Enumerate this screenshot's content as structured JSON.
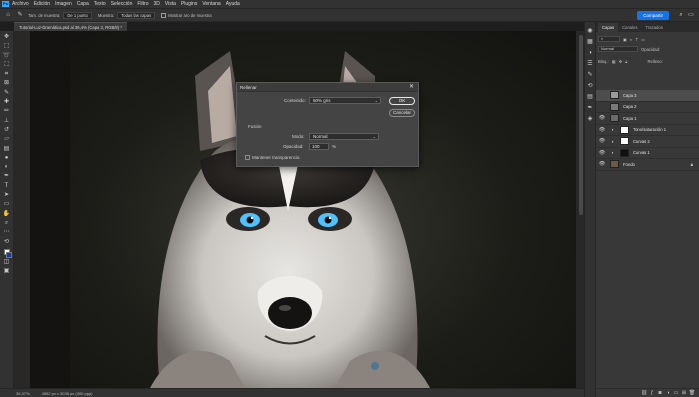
{
  "menu": {
    "app_icon": "Ps",
    "items": [
      "Archivo",
      "Edición",
      "Imagen",
      "Capa",
      "Texto",
      "Selección",
      "Filtro",
      "3D",
      "Vista",
      "Plugins",
      "Ventana",
      "Ayuda"
    ]
  },
  "options": {
    "sample_size_label": "Tam. de muestra:",
    "sample_size_value": "De 1 punto",
    "sample_label": "Muestra:",
    "sample_value": "Todas las capas",
    "ring_label": "Mostrar aro de muestra",
    "share_label": "Compartir"
  },
  "document": {
    "tab_title": "Tutorial-Luz-Dramática.psd al 36,4% (Capa 3, RGB/8) *"
  },
  "status": {
    "zoom": "36,37%",
    "info": "4552 px x 3035 px (300 ppp)"
  },
  "dialog": {
    "title": "Rellenar",
    "contents_label": "Contenido:",
    "contents_value": "50% gris",
    "ok_label": "OK",
    "cancel_label": "Cancelar",
    "fusion_label": "Fusión",
    "mode_label": "Modo:",
    "mode_value": "Normal",
    "opacity_label": "Opacidad:",
    "opacity_value": "100",
    "opacity_unit": "%",
    "preserve_label": "Mantener transparencia"
  },
  "panel": {
    "tabs": [
      "Capas",
      "Canales",
      "Trazados"
    ],
    "kind_label": "Normal",
    "opacity_label": "Opacidad:",
    "lock_label": "Bloq.:",
    "fill_label": "Relleno:",
    "layers": [
      {
        "name": "Capa 3",
        "visible": false,
        "selected": true,
        "thumb": "#9a9a9a",
        "adjustment": false,
        "locked": false
      },
      {
        "name": "Capa 2",
        "visible": false,
        "selected": false,
        "thumb": "#7a7a7a",
        "adjustment": false,
        "locked": false
      },
      {
        "name": "Capa 1",
        "visible": true,
        "selected": false,
        "thumb": "#6a6a6a",
        "adjustment": false,
        "locked": false
      },
      {
        "name": "Tono/saturación 1",
        "visible": true,
        "selected": false,
        "thumb": "#ffffff",
        "adjustment": true,
        "locked": false
      },
      {
        "name": "Curvas 2",
        "visible": true,
        "selected": false,
        "thumb": "#ffffff",
        "adjustment": true,
        "locked": false
      },
      {
        "name": "Curvas 1",
        "visible": true,
        "selected": false,
        "thumb": "#111111",
        "adjustment": true,
        "locked": false
      },
      {
        "name": "Fondo",
        "visible": true,
        "selected": false,
        "thumb": "#6b5a45",
        "adjustment": false,
        "locked": true
      }
    ]
  },
  "colors": {
    "accent": "#1473e6",
    "eye_blue": "#4ec3ff",
    "foreground": "#ffffff",
    "background": "#1a3a9a"
  }
}
